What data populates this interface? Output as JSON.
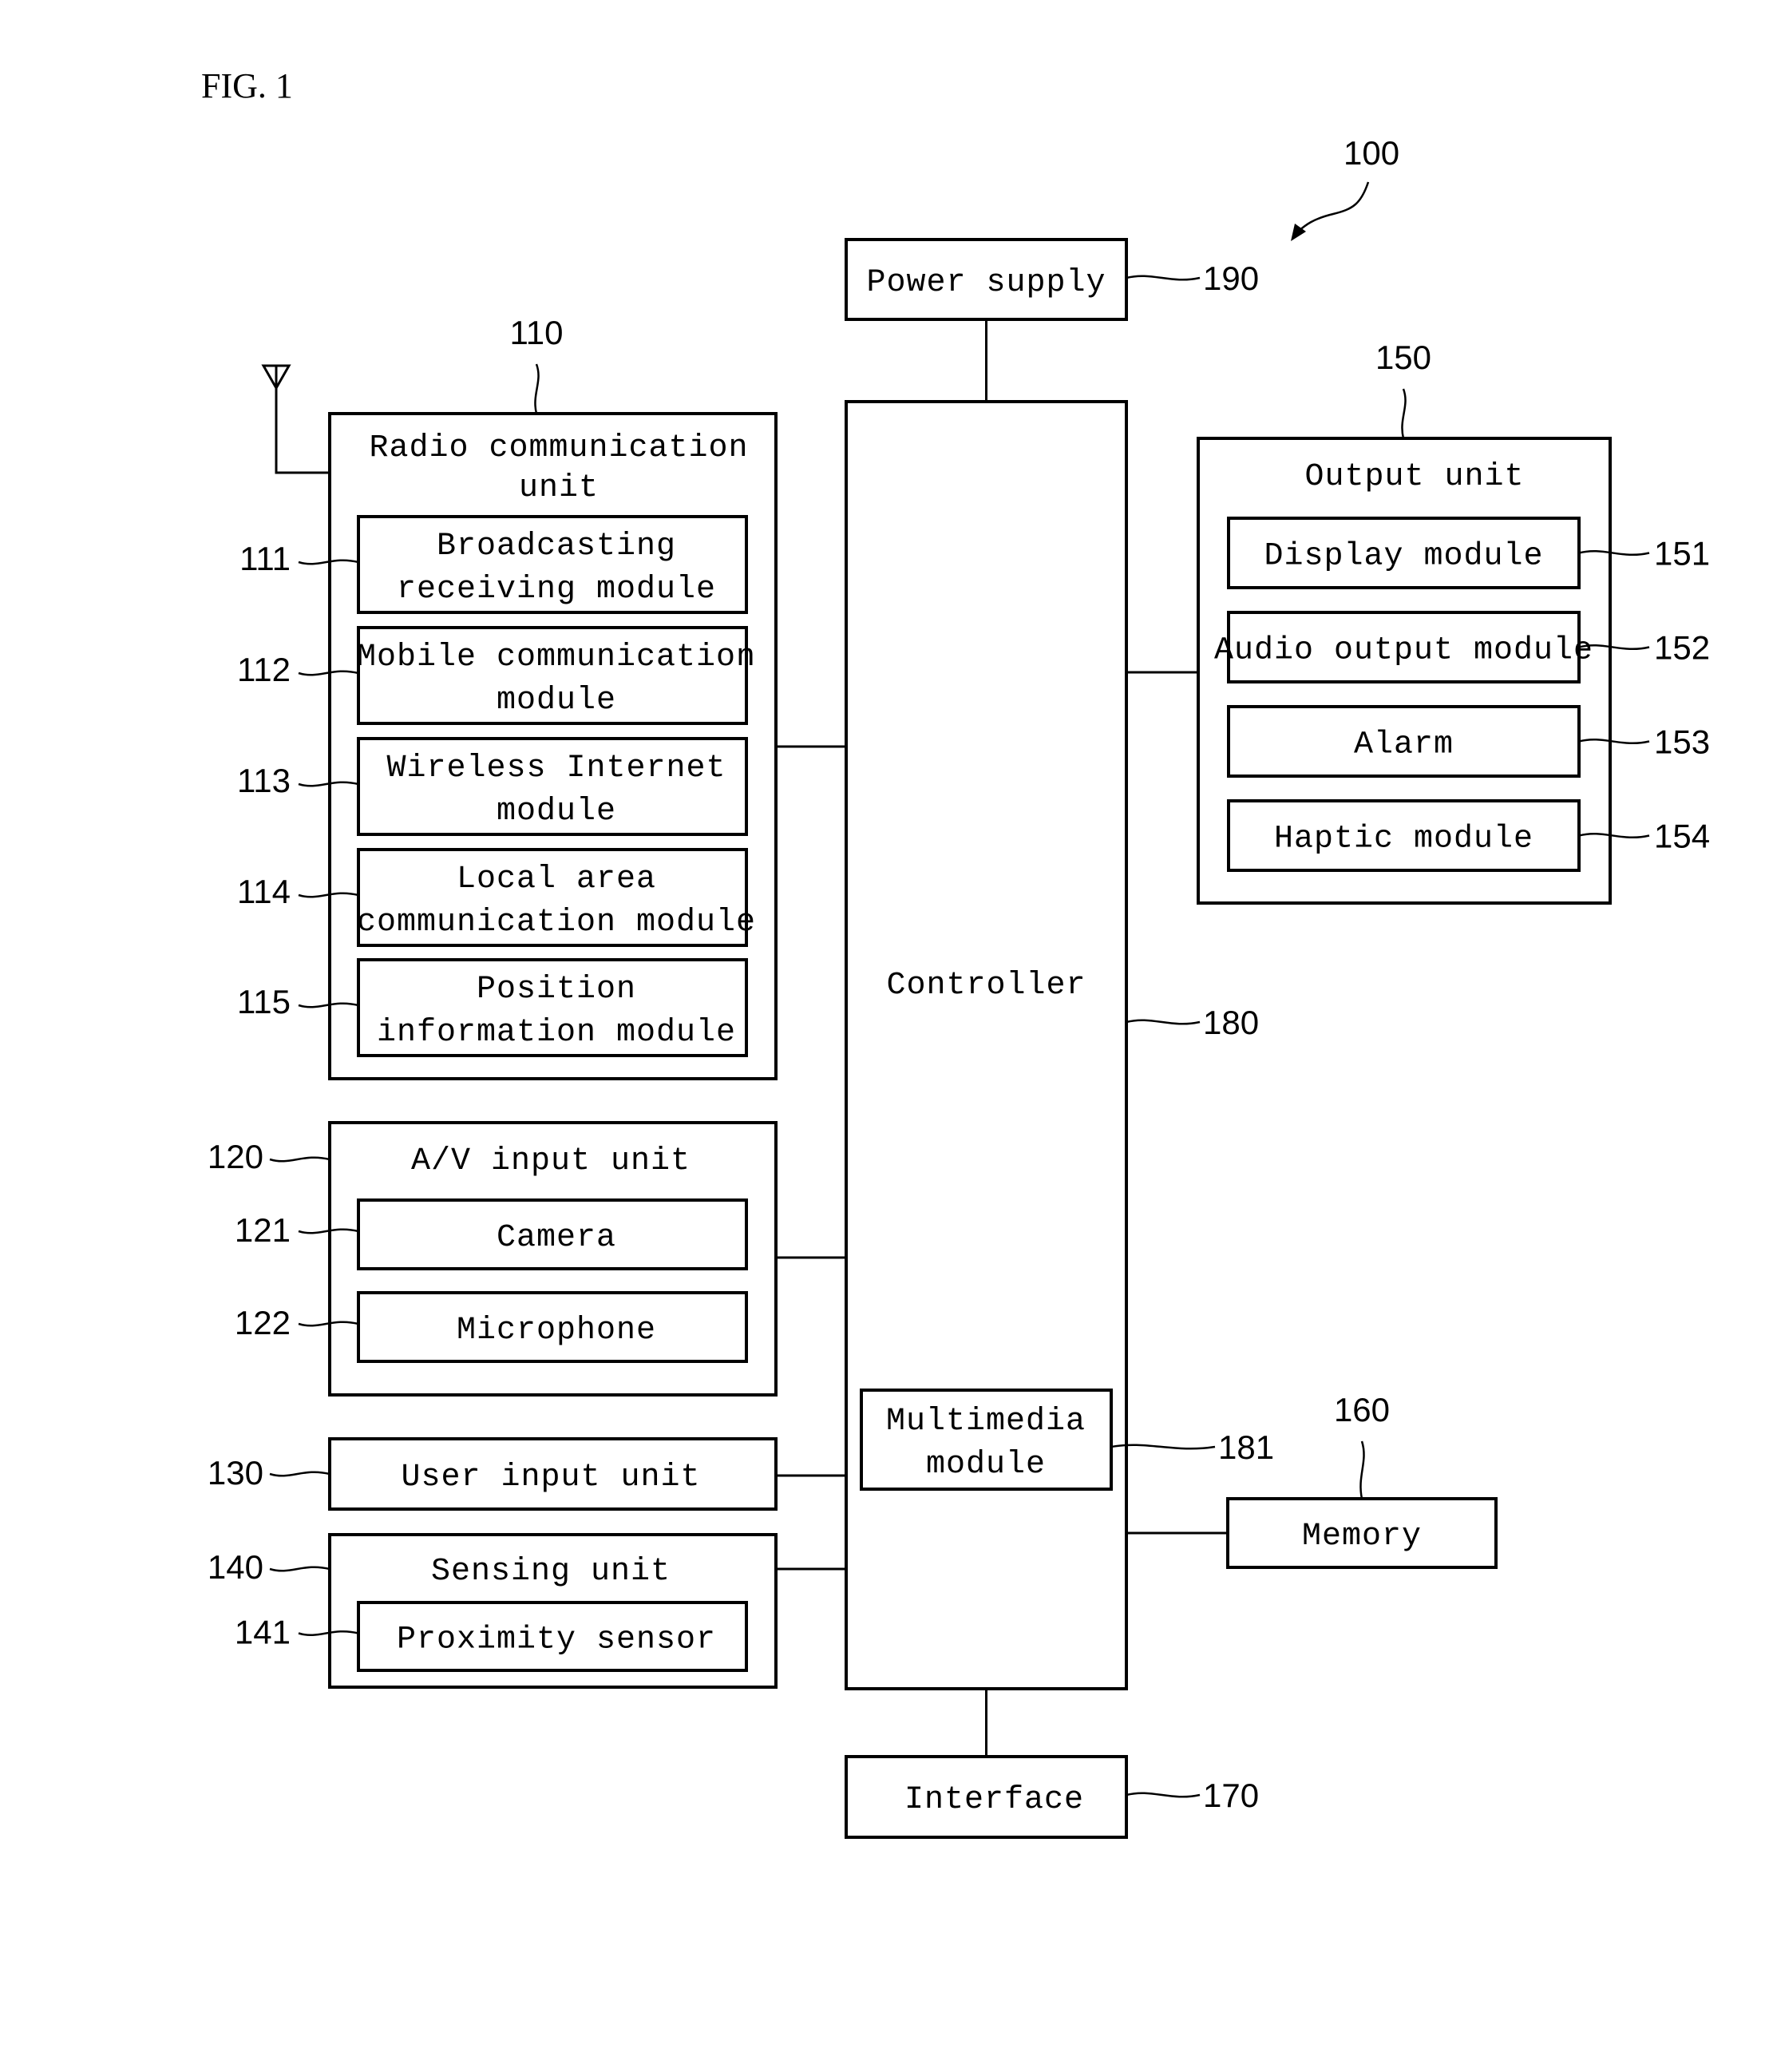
{
  "figure": {
    "title": "FIG. 1",
    "device_ref": "100"
  },
  "blocks": {
    "power_supply": {
      "label": [
        "Power supply"
      ],
      "ref": "190"
    },
    "controller": {
      "label": [
        "Controller"
      ],
      "ref": "180"
    },
    "multimedia": {
      "label": [
        "Multimedia",
        "module"
      ],
      "ref": "181"
    },
    "interface": {
      "label": [
        "Interface"
      ],
      "ref": "170"
    },
    "memory": {
      "label": [
        "Memory"
      ],
      "ref": "160"
    },
    "radio": {
      "label": [
        "Radio communication",
        "unit"
      ],
      "ref": "110",
      "children": [
        {
          "label": [
            "Broadcasting",
            "receiving module"
          ],
          "ref": "111"
        },
        {
          "label": [
            "Mobile communication",
            "module"
          ],
          "ref": "112"
        },
        {
          "label": [
            "Wireless Internet",
            "module"
          ],
          "ref": "113"
        },
        {
          "label": [
            "Local area",
            "communication module"
          ],
          "ref": "114"
        },
        {
          "label": [
            "Position",
            "information module"
          ],
          "ref": "115"
        }
      ]
    },
    "av_input": {
      "label": [
        "A/V input unit"
      ],
      "ref": "120",
      "children": [
        {
          "label": [
            "Camera"
          ],
          "ref": "121"
        },
        {
          "label": [
            "Microphone"
          ],
          "ref": "122"
        }
      ]
    },
    "user_input": {
      "label": [
        "User input unit"
      ],
      "ref": "130"
    },
    "sensing": {
      "label": [
        "Sensing unit"
      ],
      "ref": "140",
      "children": [
        {
          "label": [
            "Proximity sensor"
          ],
          "ref": "141"
        }
      ]
    },
    "output": {
      "label": [
        "Output unit"
      ],
      "ref": "150",
      "children": [
        {
          "label": [
            "Display module"
          ],
          "ref": "151"
        },
        {
          "label": [
            "Audio output module"
          ],
          "ref": "152"
        },
        {
          "label": [
            "Alarm"
          ],
          "ref": "153"
        },
        {
          "label": [
            "Haptic module"
          ],
          "ref": "154"
        }
      ]
    }
  }
}
